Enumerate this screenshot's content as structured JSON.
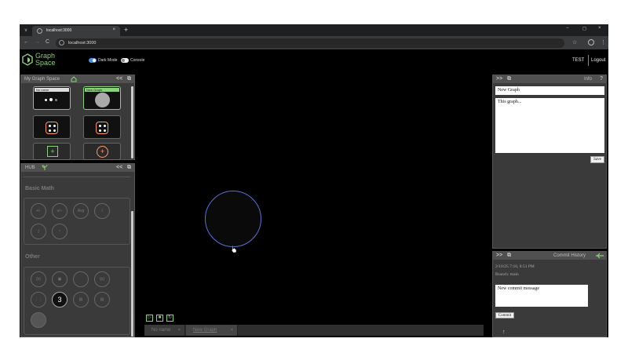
{
  "browser": {
    "tab_title": "localhost:3000",
    "url": "localhost:3000",
    "tab_close_glyph": "×",
    "new_tab_glyph": "+",
    "back_glyph": "←",
    "forward_glyph": "→",
    "reload_glyph": "C",
    "tab_menu_glyph": "v",
    "minimize_glyph": "−",
    "restore_glyph": "◻",
    "close_glyph": "×",
    "bookmark_glyph": "☆",
    "menu_glyph": "⋮"
  },
  "app": {
    "logo_line1": "Graph",
    "logo_line2": "Space",
    "accent_color": "#8bd07a",
    "toggles": [
      {
        "label": "Dark Mode",
        "on": true
      },
      {
        "label": "Console",
        "on": false
      }
    ],
    "user": "TEST",
    "logout": "Logout"
  },
  "my_graph_space": {
    "title": "My Graph Space",
    "collapse_glyph": "<<",
    "expand_glyph": "⧉",
    "home_icon": "home-icon",
    "thumbnails": [
      {
        "name": "No name",
        "type": "nodes"
      },
      {
        "name": "New Graph",
        "type": "circle"
      },
      {
        "name": "",
        "type": "dice"
      },
      {
        "name": "",
        "type": "dice"
      },
      {
        "name": "",
        "type": "add"
      },
      {
        "name": "",
        "type": "add"
      }
    ],
    "add_glyph": "+"
  },
  "hub": {
    "title": "HUB",
    "collapse_glyph": "<<",
    "expand_glyph": "⧉",
    "sections": [
      {
        "title": "Basic Math",
        "nodes": [
          "+/-",
          "x/÷",
          "Avg",
          "√",
          "∫",
          "~"
        ]
      },
      {
        "title": "Other",
        "nodes": [
          "{x}",
          "▣",
          "",
          "{x}",
          "⋮⋮",
          "3",
          "▤",
          "▤",
          ""
        ]
      }
    ]
  },
  "canvas": {
    "controls": [
      "▷",
      "■",
      "↻"
    ],
    "tabs": [
      {
        "label": "No name",
        "close": "×"
      },
      {
        "label": "New Graph",
        "close": "×"
      }
    ]
  },
  "info": {
    "title": "Info",
    "collapse_glyph": ">>",
    "expand_glyph": "⧉",
    "help_glyph": "?",
    "graph_name": "New Graph",
    "description": "This graph...",
    "save": "Save"
  },
  "commit": {
    "title": "Commit History",
    "collapse_glyph": ">>",
    "expand_glyph": "⧉",
    "timestamp": "2/10/25 7:10, 8:51 PM",
    "branch": "Branch: main",
    "message_placeholder": "New commit message",
    "commit": "Commit",
    "arrow_glyph": "↑"
  }
}
